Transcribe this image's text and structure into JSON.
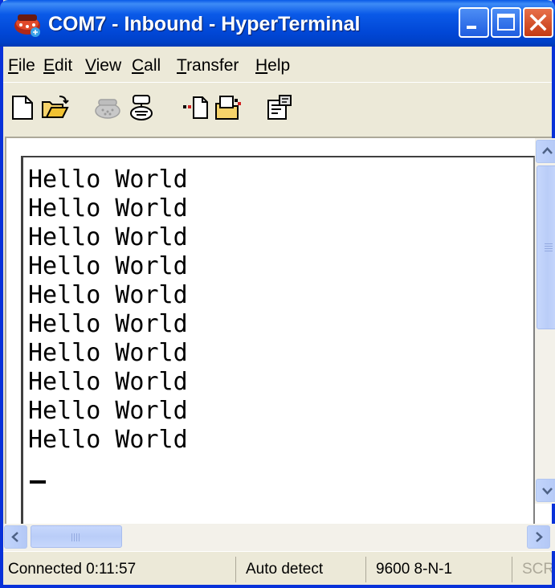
{
  "window": {
    "title": "COM7 - Inbound - HyperTerminal",
    "icon": "hyperterminal-phone-icon"
  },
  "title_buttons": {
    "minimize_icon": "minimize-icon",
    "maximize_icon": "maximize-icon",
    "close_icon": "close-icon"
  },
  "menu": {
    "items": [
      {
        "accel": "F",
        "rest": "ile"
      },
      {
        "accel": "E",
        "rest": "dit"
      },
      {
        "accel": "V",
        "rest": "iew"
      },
      {
        "accel": "C",
        "rest": "all"
      },
      {
        "accel": "T",
        "rest": "ransfer"
      },
      {
        "accel": "H",
        "rest": "elp"
      }
    ]
  },
  "toolbar": {
    "tools": [
      "new-icon",
      "open-icon",
      "connect-icon",
      "disconnect-icon",
      "send-icon",
      "receive-icon",
      "properties-icon"
    ]
  },
  "terminal": {
    "lines": [
      "Hello World",
      "Hello World",
      "Hello World",
      "Hello World",
      "Hello World",
      "Hello World",
      "Hello World",
      "Hello World",
      "Hello World",
      "Hello World"
    ]
  },
  "statusbar": {
    "connection": "Connected 0:11:57",
    "detect": "Auto detect",
    "port_settings": "9600 8-N-1",
    "scroll_lock": "SCRO"
  },
  "colors": {
    "titlebar": "#0a5ae8",
    "window_face": "#ece9d8",
    "close_button": "#d84a24"
  }
}
